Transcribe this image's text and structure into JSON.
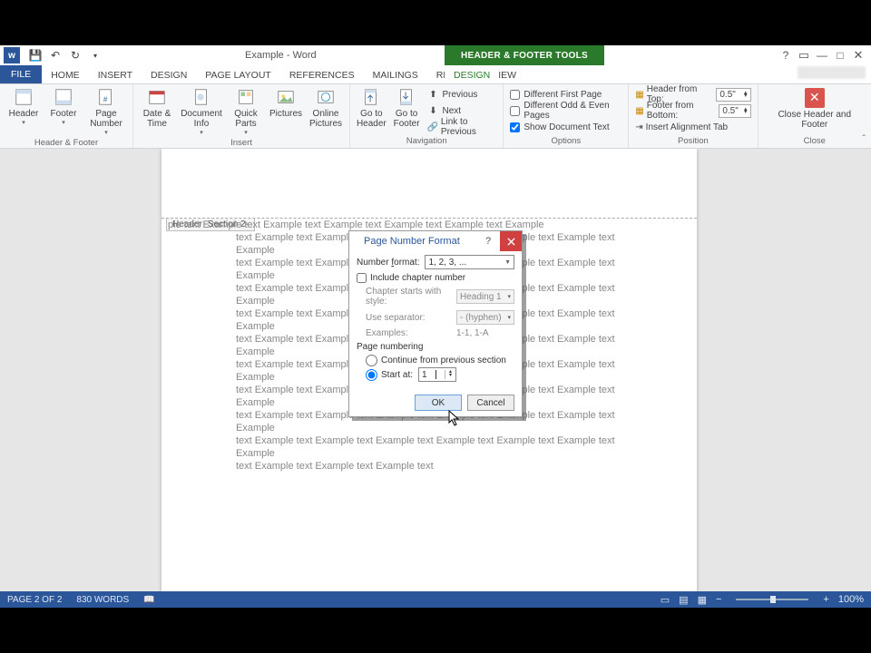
{
  "qat": {
    "title": "Example - Word",
    "tools_title": "HEADER & FOOTER TOOLS"
  },
  "tabs": {
    "file": "FILE",
    "home": "HOME",
    "insert": "INSERT",
    "design": "DESIGN",
    "page_layout": "PAGE LAYOUT",
    "references": "REFERENCES",
    "mailings": "MAILINGS",
    "review": "REVIEW",
    "view": "VIEW",
    "ctx_design": "DESIGN"
  },
  "ribbon": {
    "header_footer": {
      "label": "Header & Footer",
      "header": "Header",
      "footer": "Footer",
      "page_number": "Page Number"
    },
    "insert": {
      "label": "Insert",
      "date_time": "Date & Time",
      "doc_info": "Document Info",
      "quick_parts": "Quick Parts",
      "pictures": "Pictures",
      "online_pictures": "Online Pictures"
    },
    "navigation": {
      "label": "Navigation",
      "goto_header": "Go to Header",
      "goto_footer": "Go to Footer",
      "previous": "Previous",
      "next": "Next",
      "link_prev": "Link to Previous"
    },
    "options": {
      "label": "Options",
      "diff_first": "Different First Page",
      "diff_odd_even": "Different Odd & Even Pages",
      "show_doc": "Show Document Text"
    },
    "position": {
      "label": "Position",
      "from_top": "Header from Top:",
      "from_bottom": "Footer from Bottom:",
      "align_tab": "Insert Alignment Tab",
      "top_val": "0.5\"",
      "bot_val": "0.5\""
    },
    "close": {
      "label": "Close",
      "btn": "Close Header and Footer"
    }
  },
  "page": {
    "header_tag": "Header -Section 2-",
    "body_line": "text Example text Example text Example text Example text Example text Example text Example",
    "body_first": "ple text Example text Example text Example text Example text Example text Example"
  },
  "dialog": {
    "title": "Page Number Format",
    "number_format_label": "Number format:",
    "number_format_value": "1, 2, 3, ...",
    "include_chapter": "Include chapter number",
    "chapter_style_label": "Chapter starts with style:",
    "chapter_style_value": "Heading 1",
    "separator_label": "Use separator:",
    "separator_value": "-  (hyphen)",
    "examples_label": "Examples:",
    "examples_value": "1-1, 1-A",
    "page_numbering": "Page numbering",
    "continue": "Continue from previous section",
    "start_at": "Start at:",
    "start_val": "1",
    "ok": "OK",
    "cancel": "Cancel"
  },
  "status": {
    "page": "PAGE 2 OF 2",
    "words": "830 WORDS",
    "zoom": "100%"
  }
}
